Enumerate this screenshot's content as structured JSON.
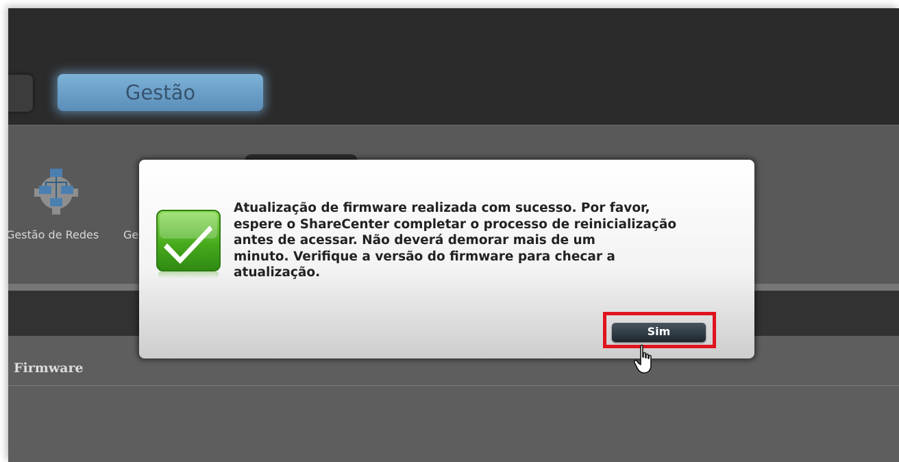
{
  "top_nav": {
    "active_tab": "Gestão"
  },
  "toolbar": {
    "items": [
      {
        "label": "Gestão de Redes",
        "icon": "network-gear-icon"
      },
      {
        "label": "Ge"
      }
    ]
  },
  "section": {
    "title": "Firmware"
  },
  "dialog": {
    "message_lines": [
      "Atualização de firmware realizada com sucesso. Por favor,",
      "espere o ShareCenter completar o processo de reinicialização",
      "antes de acessar. Não deverá demorar mais de um",
      "minuto. Verifique a versão do firmware para checar a",
      "atualização."
    ],
    "icon": "success-check-icon",
    "confirm_label": "Sim",
    "highlight_color": "#e0131e"
  },
  "colors": {
    "active_tab": "#6fa3cc",
    "success_green": "#4caa22"
  }
}
